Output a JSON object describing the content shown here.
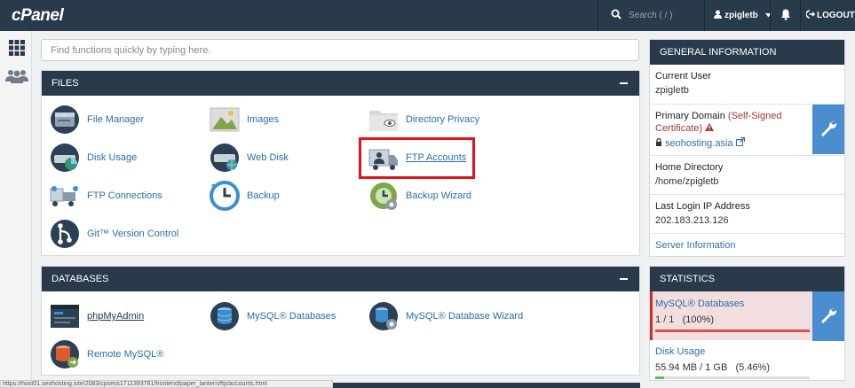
{
  "brand": "cPanel",
  "header": {
    "search_placeholder": "Search ( / )",
    "username": "zpigletb",
    "logout_label": "LOGOUT"
  },
  "quick_search_placeholder": "Find functions quickly by typing here.",
  "files": {
    "title": "FILES",
    "items": [
      {
        "label": "File Manager",
        "icon": "file-manager-icon"
      },
      {
        "label": "Images",
        "icon": "images-icon"
      },
      {
        "label": "Directory Privacy",
        "icon": "directory-privacy-icon"
      },
      {
        "label": "Disk Usage",
        "icon": "disk-usage-icon"
      },
      {
        "label": "Web Disk",
        "icon": "web-disk-icon"
      },
      {
        "label": "FTP Accounts",
        "icon": "ftp-accounts-icon"
      },
      {
        "label": "FTP Connections",
        "icon": "ftp-connections-icon"
      },
      {
        "label": "Backup",
        "icon": "backup-icon"
      },
      {
        "label": "Backup Wizard",
        "icon": "backup-wizard-icon"
      },
      {
        "label": "Git™ Version Control",
        "icon": "git-icon"
      }
    ]
  },
  "databases": {
    "title": "DATABASES",
    "items": [
      {
        "label": "phpMyAdmin",
        "icon": "phpmyadmin-icon"
      },
      {
        "label": "MySQL® Databases",
        "icon": "mysql-databases-icon"
      },
      {
        "label": "MySQL® Database Wizard",
        "icon": "mysql-wizard-icon"
      },
      {
        "label": "Remote MySQL®",
        "icon": "remote-mysql-icon"
      }
    ]
  },
  "general_info": {
    "title": "GENERAL INFORMATION",
    "current_user_label": "Current User",
    "current_user": "zpigletb",
    "primary_domain_label": "Primary Domain",
    "ssl_status": "(Self-Signed Certificate)",
    "domain": "seohosting.asia",
    "home_dir_label": "Home Directory",
    "home_dir": "/home/zpigletb",
    "last_ip_label": "Last Login IP Address",
    "last_ip": "202.183.213.126",
    "server_info_link": "Server Information"
  },
  "statistics": {
    "title": "STATISTICS",
    "mysql_label": "MySQL® Databases",
    "mysql_value": "1 / 1   (100%)",
    "mysql_percent": 100,
    "disk_label": "Disk Usage",
    "disk_value": "55.94 MB / 1 GB   (5.46%)",
    "disk_percent": 5.46
  },
  "status_bar_url": "https://host01.seohosting.site/2083/cpsess1711393761/frontend/paper_lantern/ftp/accounts.html",
  "colors": {
    "header_bg": "#293a4a",
    "accent_blue": "#4a8ed0",
    "link": "#2b6eaa",
    "highlight_red": "#e0141b",
    "danger_bg": "#f2dede"
  }
}
